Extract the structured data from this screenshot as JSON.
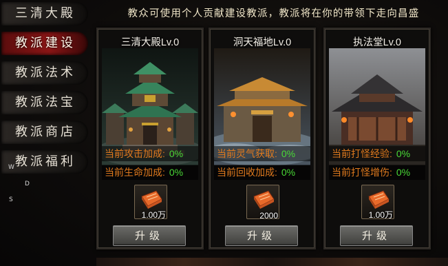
{
  "nav": {
    "items": [
      {
        "label": "三清大殿",
        "active": false
      },
      {
        "label": "教派建设",
        "active": true
      },
      {
        "label": "教派法术",
        "active": false
      },
      {
        "label": "教派法宝",
        "active": false
      },
      {
        "label": "教派商店",
        "active": false
      },
      {
        "label": "教派福利",
        "active": false
      }
    ],
    "stray_letters": [
      "W",
      "D",
      "S"
    ]
  },
  "banner": "教众可使用个人贡献建设教派，教派将在你的带领下走向昌盛",
  "cards": [
    {
      "title": "三清大殿Lv.0",
      "stats": [
        {
          "label": "当前攻击加成:",
          "value": "0%"
        },
        {
          "label": "当前生命加成:",
          "value": "0%"
        }
      ],
      "cost": "1.00万",
      "upgrade_label": "升级"
    },
    {
      "title": "洞天福地Lv.0",
      "stats": [
        {
          "label": "当前灵气获取:",
          "value": "0%"
        },
        {
          "label": "当前回收加成:",
          "value": "0%"
        }
      ],
      "cost": "2000",
      "upgrade_label": "升级"
    },
    {
      "title": "执法堂Lv.0",
      "stats": [
        {
          "label": "当前打怪经验:",
          "value": "0%"
        },
        {
          "label": "当前打怪增伤:",
          "value": "0%"
        }
      ],
      "cost": "1.00万",
      "upgrade_label": "升级"
    }
  ],
  "colors": {
    "stat_label": "#e07a1e",
    "stat_value": "#49d836",
    "active_tab": "#8c1616"
  },
  "icons": {
    "cost_item": "gold-ingot-token-icon"
  }
}
